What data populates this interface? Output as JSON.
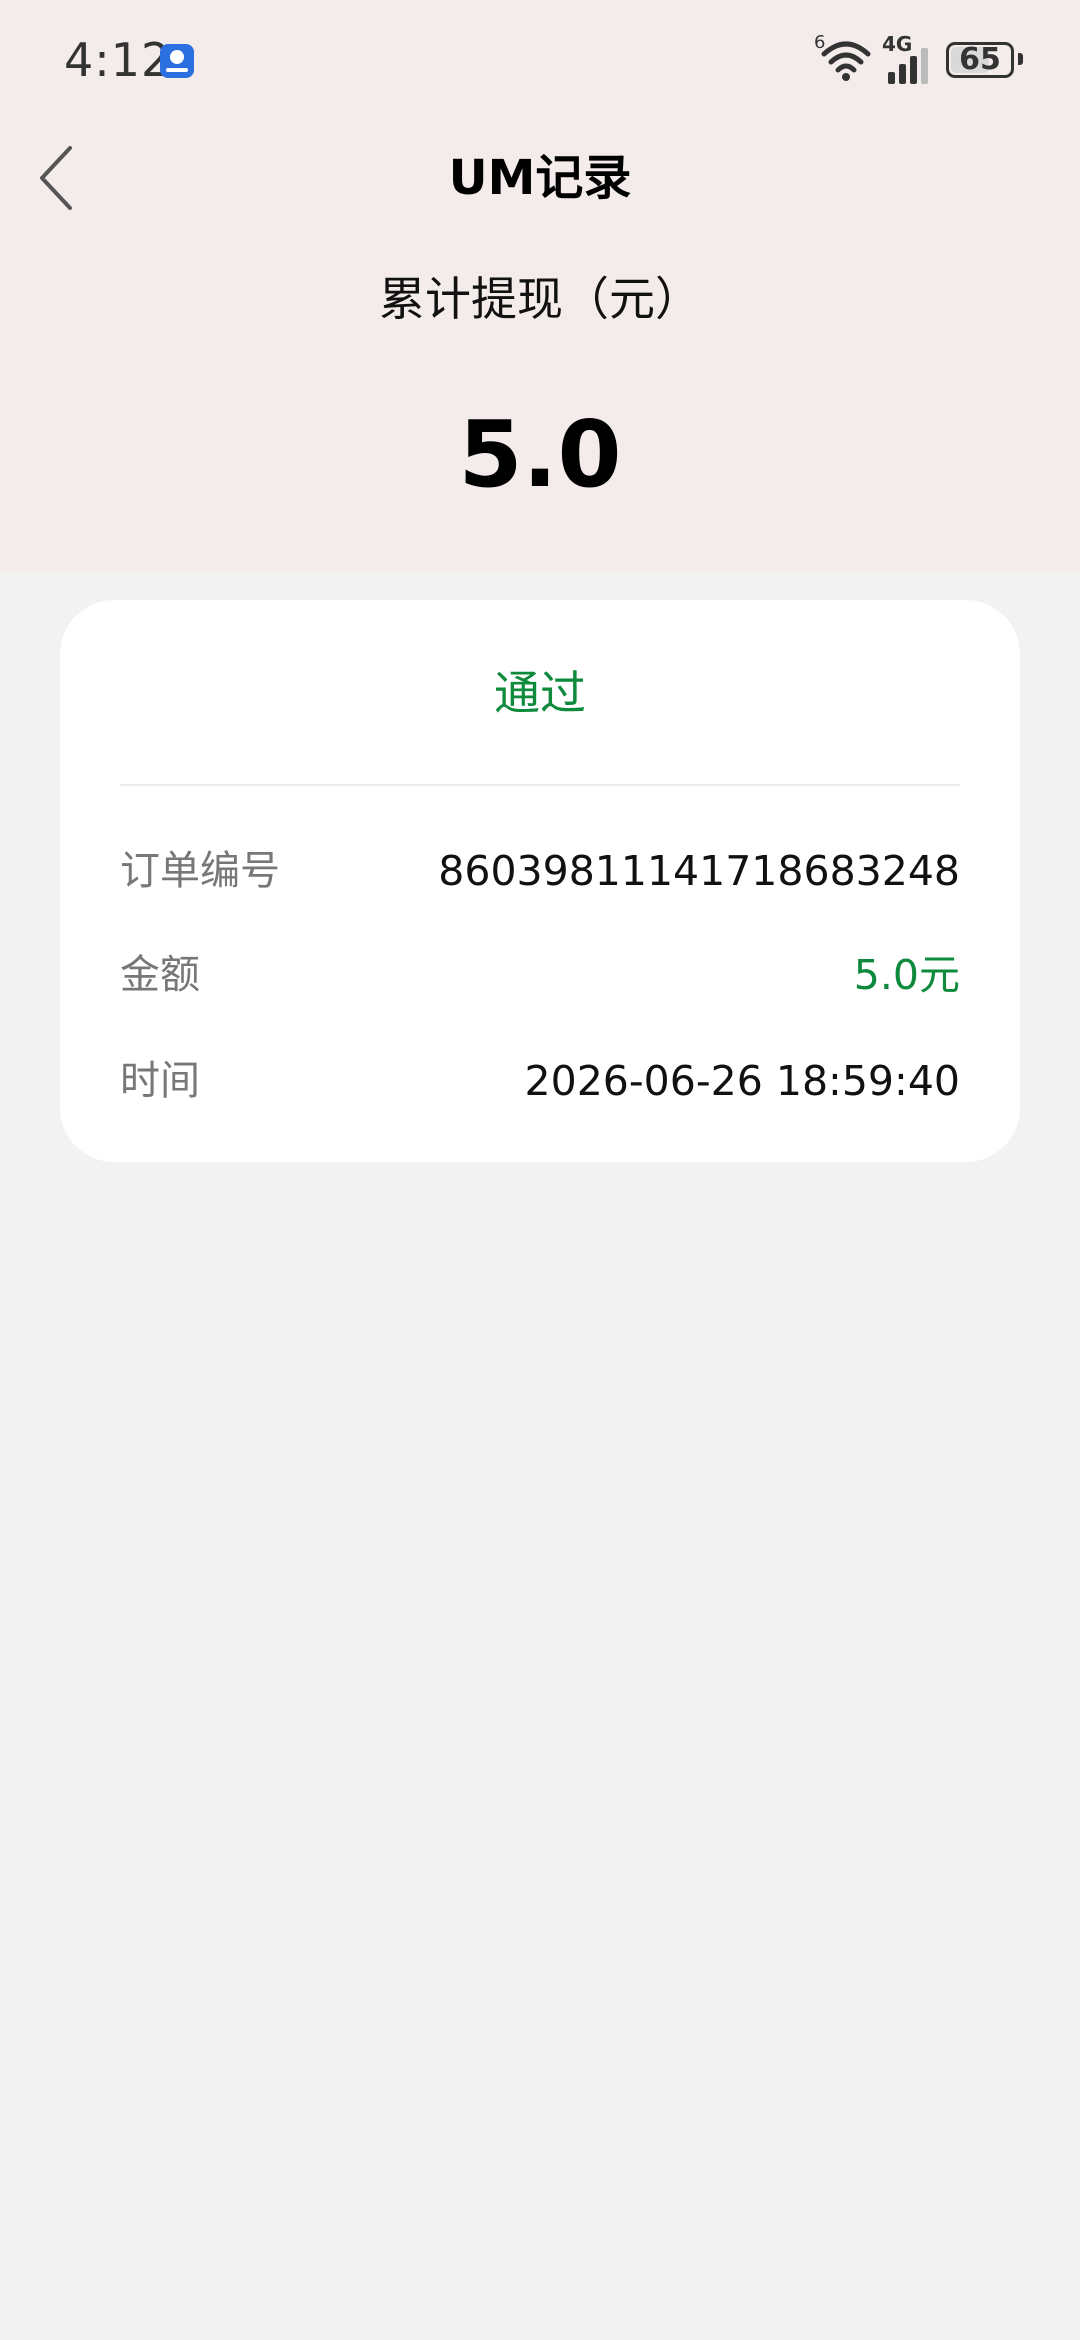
{
  "status_bar": {
    "time": "4:12",
    "wifi_label": "6",
    "network_label": "4G",
    "battery": "65",
    "battery_level": 65
  },
  "nav": {
    "title": "UM记录"
  },
  "summary": {
    "label": "累计提现（元）",
    "value": "5.0"
  },
  "record": {
    "status": "通过",
    "order_label": "订单编号",
    "order_value": "860398111417186832​48",
    "amount_label": "金额",
    "amount_value": "5.0元",
    "time_label": "时间",
    "time_value": "2026-06-26 18:59:40"
  },
  "colors": {
    "header_bg": "#f3ecea",
    "page_bg": "#f2f2f2",
    "accent_green": "#0d8a3c"
  }
}
